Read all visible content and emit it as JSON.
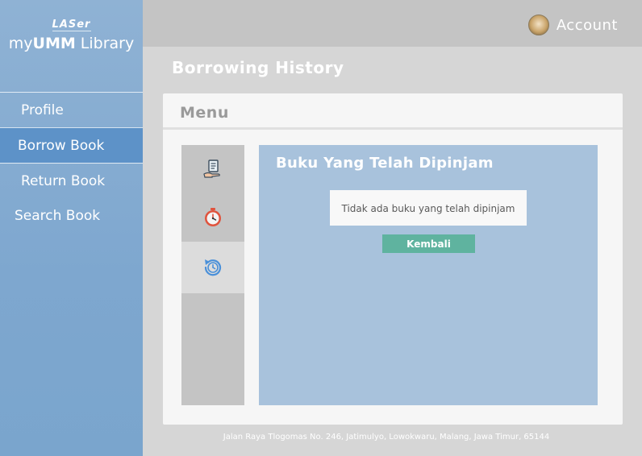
{
  "sidebar": {
    "logo_brand": "LASer",
    "logo_prefix": "my",
    "logo_bold": "UMM",
    "logo_suffix": " Library",
    "items": [
      {
        "label": "Profile"
      },
      {
        "label": "Borrow Book"
      },
      {
        "label": "Return Book"
      },
      {
        "label": "Search Book"
      }
    ],
    "active_item": "Borrow Book"
  },
  "header": {
    "account_label": "Account"
  },
  "page_title": "Borrowing History",
  "card": {
    "menu_title": "Menu",
    "menu_icons": [
      "borrow-book-icon",
      "timer-icon",
      "history-icon"
    ],
    "active_menu_icon": "history-icon",
    "content_title": "Buku Yang Telah Dipinjam",
    "empty_message": "Tidak ada buku yang telah dipinjam",
    "back_button_label": "Kembali"
  },
  "footer": {
    "address": "Jalan Raya Tlogomas No. 246, Jatimulyo, Lowokwaru, Malang, Jawa Timur, 65144"
  },
  "colors": {
    "sidebar": "#7ea7cf",
    "sidebar_active": "#5d92c8",
    "content_bg": "#a8c2dc",
    "button": "#5fb39f",
    "timer_icon": "#e0533d",
    "history_icon": "#4a90d9"
  }
}
